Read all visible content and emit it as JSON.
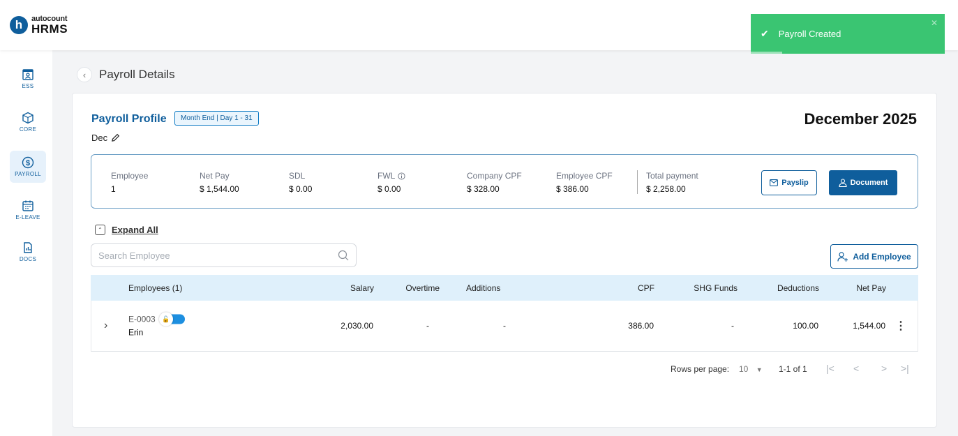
{
  "app": {
    "logo_top": "autocount",
    "logo_bottom": "HRMS",
    "logo_letter": "h"
  },
  "toast": {
    "message": "Payroll Created",
    "close": "✕"
  },
  "sidebar": {
    "items": [
      {
        "label": "ESS",
        "icon": "ess-icon"
      },
      {
        "label": "CORE",
        "icon": "core-icon"
      },
      {
        "label": "PAYROLL",
        "icon": "payroll-icon",
        "active": true
      },
      {
        "label": "E-LEAVE",
        "icon": "calendar-icon"
      },
      {
        "label": "DOCS",
        "icon": "docs-icon"
      }
    ]
  },
  "page": {
    "title": "Payroll Details"
  },
  "profile": {
    "title": "Payroll Profile",
    "badge": "Month End | Day 1 - 31",
    "period_name": "Dec",
    "month": "December 2025"
  },
  "summary": {
    "employee_label": "Employee",
    "employee_value": "1",
    "netpay_label": "Net Pay",
    "netpay_value": "$ 1,544.00",
    "sdl_label": "SDL",
    "sdl_value": "$ 0.00",
    "fwl_label": "FWL",
    "fwl_value": "$ 0.00",
    "companycpf_label": "Company CPF",
    "companycpf_value": "$ 328.00",
    "employeecpf_label": "Employee CPF",
    "employeecpf_value": "$ 386.00",
    "total_label": "Total payment",
    "total_value": "$ 2,258.00"
  },
  "actions": {
    "payslip": "Payslip",
    "document": "Document",
    "expand_all": "Expand All",
    "add_employee": "Add Employee"
  },
  "search": {
    "placeholder": "Search Employee",
    "value": ""
  },
  "table": {
    "headers": {
      "employees": "Employees (1)",
      "salary": "Salary",
      "overtime": "Overtime",
      "additions": "Additions",
      "cpf": "CPF",
      "shg": "SHG Funds",
      "deductions": "Deductions",
      "netpay": "Net Pay"
    },
    "rows": [
      {
        "code": "E-0003",
        "name": "Erin",
        "salary": "2,030.00",
        "overtime": "-",
        "additions": "-",
        "cpf": "386.00",
        "shg": "-",
        "deductions": "100.00",
        "netpay": "1,544.00"
      }
    ]
  },
  "pagination": {
    "rows_label": "Rows per page:",
    "rows_value": "10",
    "range": "1-1 of 1",
    "first": "|<",
    "prev": "<",
    "next": ">",
    "last": ">|"
  },
  "colors": {
    "primary": "#0f5e9c",
    "toast": "#3ac572",
    "header_row": "#dff0fb"
  }
}
